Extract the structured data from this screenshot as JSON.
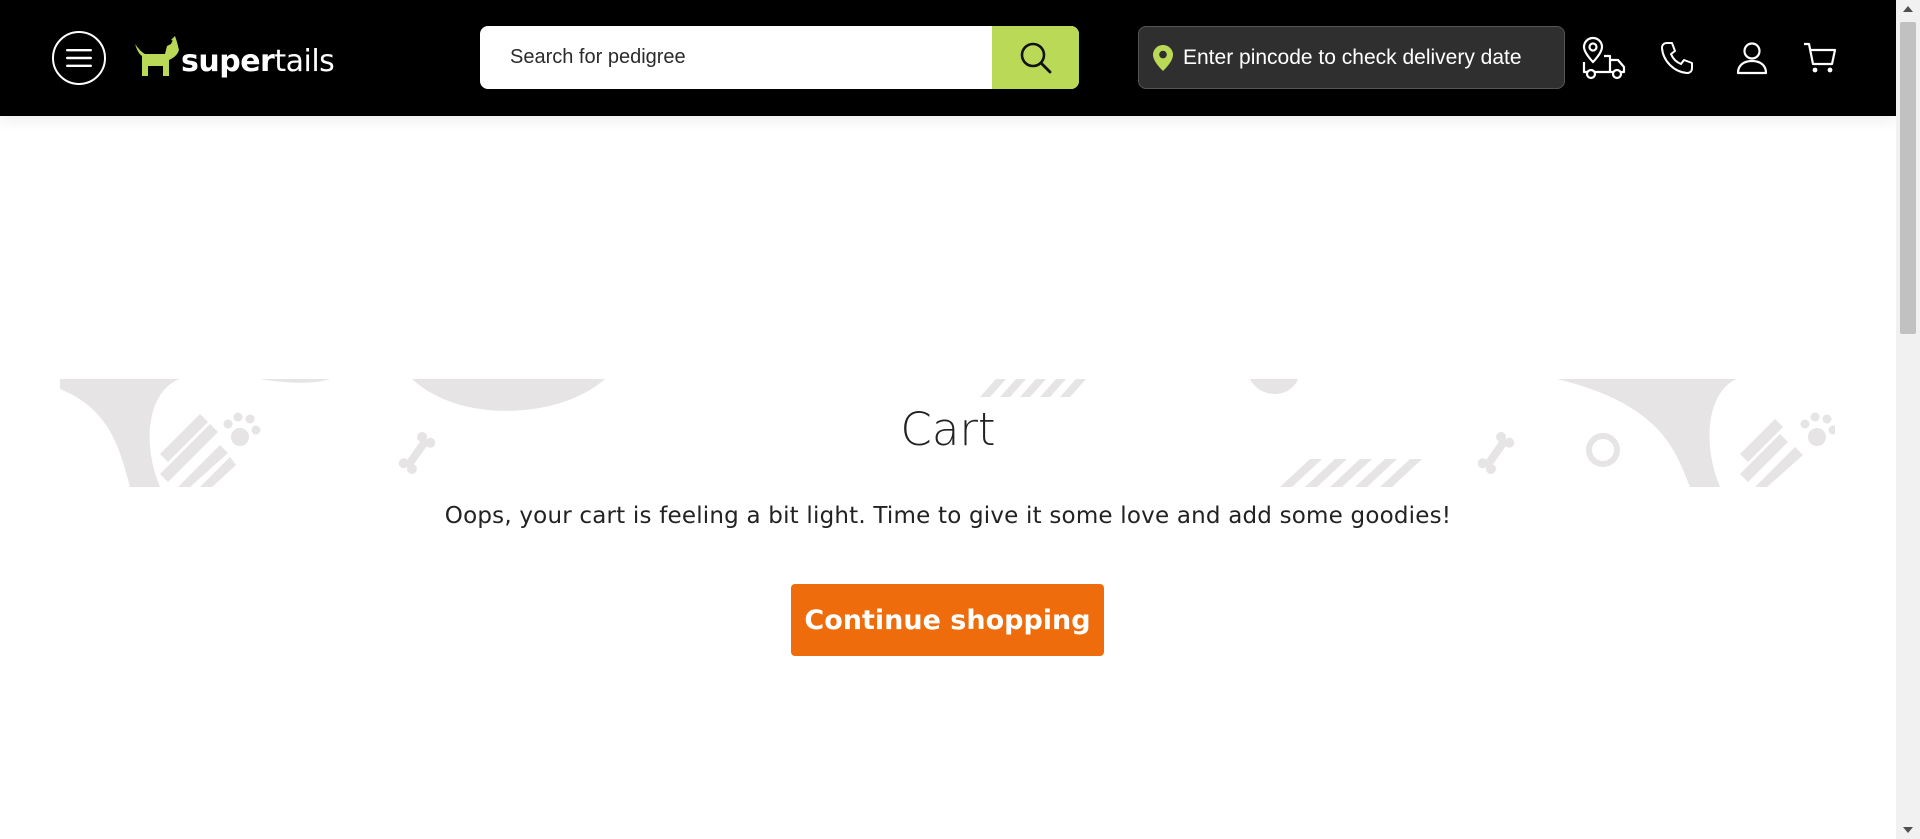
{
  "header": {
    "logo": {
      "strong": "super",
      "light": "tails"
    },
    "search": {
      "placeholder": "Search for pedigree"
    },
    "pincode": {
      "label": "Enter pincode to check delivery date"
    }
  },
  "main": {
    "title": "Cart",
    "message": "Oops, your cart is feeling a bit light. Time to give it some love and add some goodies!",
    "continue_label": "Continue shopping"
  },
  "colors": {
    "header_bg": "#000000",
    "accent_green": "#b9d957",
    "button_orange": "#ee6c0c",
    "banner_pattern": "#e6e4e4"
  },
  "icons": {
    "menu": "hamburger-icon",
    "search": "search-icon",
    "location": "location-pin-icon",
    "delivery": "delivery-truck-icon",
    "phone": "phone-icon",
    "account": "user-icon",
    "cart": "cart-icon"
  }
}
